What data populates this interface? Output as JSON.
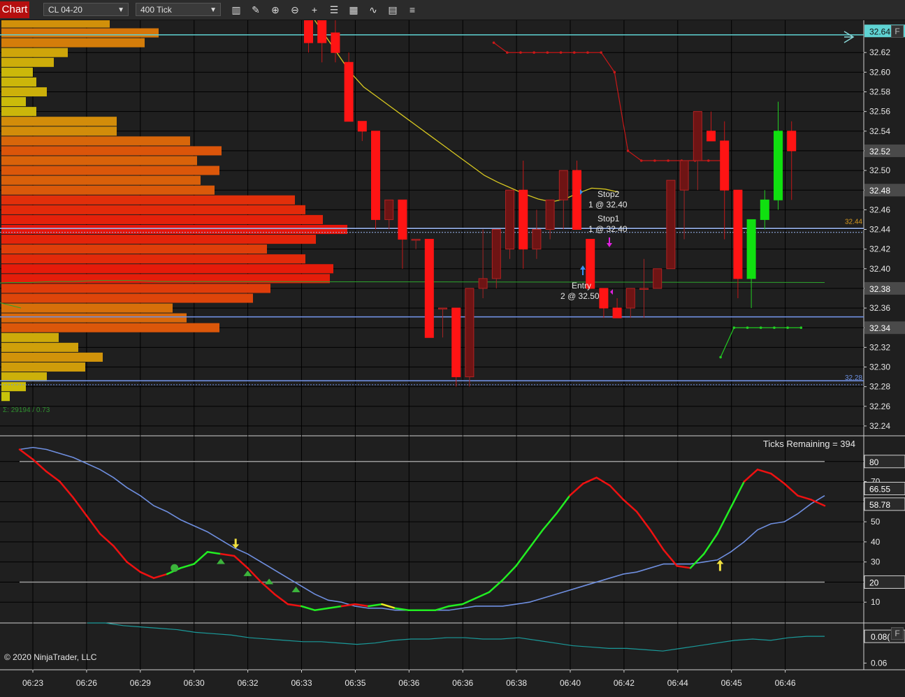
{
  "toolbar": {
    "title": "Chart",
    "instrument": "CL 04-20",
    "interval": "400 Tick",
    "buttons": [
      {
        "name": "bars-icon",
        "glyph": "▥"
      },
      {
        "name": "pencil-icon",
        "glyph": "✎"
      },
      {
        "name": "zoom-in-icon",
        "glyph": "⊕"
      },
      {
        "name": "zoom-out-icon",
        "glyph": "⊖"
      },
      {
        "name": "crosshair-icon",
        "glyph": "+"
      },
      {
        "name": "properties-icon",
        "glyph": "☰"
      },
      {
        "name": "strategy-icon",
        "glyph": "▦"
      },
      {
        "name": "indicator-icon",
        "glyph": "∿"
      },
      {
        "name": "template-icon",
        "glyph": "▤"
      },
      {
        "name": "menu-icon",
        "glyph": "≡"
      }
    ]
  },
  "chart_data": [
    {
      "type": "candlestick",
      "panel": "price",
      "ylim": [
        32.23,
        32.65
      ],
      "y_ticks": [
        32.24,
        32.26,
        32.28,
        32.3,
        32.32,
        32.34,
        32.36,
        32.38,
        32.4,
        32.42,
        32.44,
        32.46,
        32.48,
        32.5,
        32.52,
        32.54,
        32.56,
        32.58,
        32.6,
        32.62
      ],
      "price_markers": [
        {
          "label": "32.64",
          "color": "#5fd3d3"
        },
        {
          "label": "32.52",
          "color": "#4a4a4a"
        },
        {
          "label": "32.48",
          "color": "#4a4a4a"
        },
        {
          "label": "32.38",
          "color": "#4a4a4a"
        },
        {
          "label": "32.34",
          "color": "#4a4a4a"
        }
      ],
      "small_labels": [
        {
          "text": "32.44",
          "y": 32.443,
          "color": "#d89a20"
        },
        {
          "text": "32.28",
          "y": 32.284,
          "color": "#6b8fe0"
        }
      ],
      "horizontal_lines": [
        {
          "y": 32.638,
          "color": "#5fd3d3"
        },
        {
          "y": 32.441,
          "color": "#9ab6f0"
        },
        {
          "y": 32.351,
          "color": "#6f8fe0"
        },
        {
          "y": 32.286,
          "color": "#6f8fe0"
        }
      ],
      "candles": [
        {
          "o": 32.67,
          "h": 32.68,
          "l": 32.62,
          "c": 32.63
        },
        {
          "o": 32.66,
          "h": 32.67,
          "l": 32.61,
          "c": 32.63
        },
        {
          "o": 32.64,
          "h": 32.67,
          "l": 32.61,
          "c": 32.62
        },
        {
          "o": 32.61,
          "h": 32.62,
          "l": 32.55,
          "c": 32.55
        },
        {
          "o": 32.55,
          "h": 32.55,
          "l": 32.53,
          "c": 32.54
        },
        {
          "o": 32.54,
          "h": 32.54,
          "l": 32.44,
          "c": 32.45
        },
        {
          "o": 32.45,
          "h": 32.47,
          "l": 32.44,
          "c": 32.47
        },
        {
          "o": 32.47,
          "h": 32.47,
          "l": 32.4,
          "c": 32.43
        },
        {
          "o": 32.43,
          "h": 32.43,
          "l": 32.42,
          "c": 32.43
        },
        {
          "o": 32.43,
          "h": 32.43,
          "l": 32.33,
          "c": 32.33
        },
        {
          "o": 32.36,
          "h": 32.36,
          "l": 32.33,
          "c": 32.36
        },
        {
          "o": 32.36,
          "h": 32.36,
          "l": 32.28,
          "c": 32.29
        },
        {
          "o": 32.29,
          "h": 32.38,
          "l": 32.28,
          "c": 32.38
        },
        {
          "o": 32.38,
          "h": 32.44,
          "l": 32.37,
          "c": 32.39
        },
        {
          "o": 32.39,
          "h": 32.44,
          "l": 32.38,
          "c": 32.44
        },
        {
          "o": 32.42,
          "h": 32.48,
          "l": 32.41,
          "c": 32.48
        },
        {
          "o": 32.48,
          "h": 32.51,
          "l": 32.4,
          "c": 32.42
        },
        {
          "o": 32.42,
          "h": 32.46,
          "l": 32.41,
          "c": 32.44
        },
        {
          "o": 32.44,
          "h": 32.47,
          "l": 32.43,
          "c": 32.47
        },
        {
          "o": 32.47,
          "h": 32.5,
          "l": 32.44,
          "c": 32.5
        },
        {
          "o": 32.5,
          "h": 32.51,
          "l": 32.44,
          "c": 32.44
        },
        {
          "o": 32.43,
          "h": 32.43,
          "l": 32.38,
          "c": 32.38
        },
        {
          "o": 32.38,
          "h": 32.38,
          "l": 32.35,
          "c": 32.36
        },
        {
          "o": 32.36,
          "h": 32.37,
          "l": 32.35,
          "c": 32.35
        },
        {
          "o": 32.36,
          "h": 32.38,
          "l": 32.35,
          "c": 32.38
        },
        {
          "o": 32.38,
          "h": 32.41,
          "l": 32.35,
          "c": 32.38
        },
        {
          "o": 32.38,
          "h": 32.4,
          "l": 32.38,
          "c": 32.4
        },
        {
          "o": 32.4,
          "h": 32.49,
          "l": 32.4,
          "c": 32.49
        },
        {
          "o": 32.48,
          "h": 32.51,
          "l": 32.43,
          "c": 32.51
        },
        {
          "o": 32.51,
          "h": 32.56,
          "l": 32.48,
          "c": 32.56
        },
        {
          "o": 32.54,
          "h": 32.56,
          "l": 32.53,
          "c": 32.53
        },
        {
          "o": 32.53,
          "h": 32.55,
          "l": 32.43,
          "c": 32.48
        },
        {
          "o": 32.48,
          "h": 32.48,
          "l": 32.37,
          "c": 32.39
        },
        {
          "o": 32.39,
          "h": 32.45,
          "l": 32.36,
          "c": 32.45
        },
        {
          "o": 32.45,
          "h": 32.48,
          "l": 32.44,
          "c": 32.47
        },
        {
          "o": 32.47,
          "h": 32.57,
          "l": 32.46,
          "c": 32.54
        },
        {
          "o": 32.54,
          "h": 32.55,
          "l": 32.47,
          "c": 32.52
        }
      ],
      "volume_profile": [
        32.65,
        32.64,
        32.63,
        32.62,
        32.61,
        32.6,
        32.59,
        32.58,
        32.57,
        32.56,
        32.55,
        32.54,
        32.53,
        32.52,
        32.51,
        32.5,
        32.49,
        32.48,
        32.47,
        32.46,
        32.45,
        32.44,
        32.43,
        32.42,
        32.41,
        32.4,
        32.39,
        32.38,
        32.37,
        32.36,
        32.35,
        32.34,
        32.33,
        32.32,
        32.31,
        32.3,
        32.29,
        32.28,
        32.27
      ],
      "volume_profile_sizes": [
        155,
        225,
        205,
        95,
        75,
        45,
        50,
        65,
        35,
        50,
        165,
        165,
        270,
        315,
        280,
        312,
        285,
        305,
        420,
        435,
        460,
        495,
        450,
        380,
        435,
        475,
        470,
        385,
        360,
        245,
        265,
        312,
        82,
        110,
        145,
        120,
        65,
        35,
        12
      ],
      "volume_profile_text": "Σ: 29194 / 0.73",
      "ema": [
        32.66,
        32.64,
        32.62,
        32.6,
        32.585,
        32.575,
        32.565,
        32.555,
        32.545,
        32.535,
        32.525,
        32.515,
        32.505,
        32.495,
        32.488,
        32.482,
        32.476,
        32.471,
        32.468,
        32.471,
        32.477,
        32.482,
        32.481,
        32.478
      ],
      "ema_x_start": 20,
      "ema2": [
        32.385,
        32.385,
        32.385,
        32.385,
        32.386,
        32.386,
        32.387,
        32.387,
        32.388,
        32.388,
        32.388,
        32.387
      ],
      "ema2_x_start": 13,
      "stop_line": [
        32.63,
        32.62,
        32.62,
        32.62,
        32.62,
        32.62,
        32.62,
        32.62,
        32.62,
        32.6,
        32.52,
        32.51,
        32.51,
        32.51,
        32.51,
        32.51,
        32.51,
        32.51
      ],
      "stop_line_x_start": 15,
      "green_stop": [
        32.31,
        32.34,
        32.34,
        32.34,
        32.34,
        32.34,
        32.34
      ],
      "green_stop_x_start": 30.5,
      "labels": {
        "stop2": "Stop2",
        "stop2_qty": "1 @ 32.40",
        "stop1": "Stop1",
        "stop1_qty": "1 @ 32.40",
        "entry": "Entry",
        "entry_qty": "2 @ 32.50",
        "ticks_remaining": "Ticks Remaining = 394"
      }
    },
    {
      "type": "line",
      "panel": "stochastics",
      "ylim": [
        0,
        90
      ],
      "y_ticks": [
        10,
        20,
        30,
        40,
        50,
        60,
        70,
        80
      ],
      "levels": [
        20,
        80
      ],
      "value_labels": [
        {
          "label": "80",
          "color": "#e6e6e6",
          "value": 80
        },
        {
          "label": "66.55",
          "color": "#e6e6e6",
          "value": 66.55
        },
        {
          "label": "58.78",
          "color": "#e6e6e6",
          "value": 58.78
        },
        {
          "label": "20",
          "color": "#e6e6e6",
          "value": 20
        }
      ],
      "series": [
        {
          "values": [
            86,
            81,
            75,
            70,
            62,
            53,
            44,
            38,
            30,
            25,
            22,
            24,
            27,
            29,
            35,
            34,
            33,
            27,
            20,
            14,
            9,
            8,
            6,
            7,
            8,
            9,
            8,
            9,
            7,
            6,
            6,
            6,
            8,
            9,
            12,
            15,
            21,
            28,
            37,
            46,
            54,
            63,
            69,
            72,
            68,
            61,
            55,
            46,
            36,
            28,
            27,
            34,
            44,
            57,
            70,
            76,
            74,
            69,
            63,
            61,
            58
          ]
        },
        {
          "values": [
            86,
            87,
            86,
            84,
            82,
            79,
            76,
            72,
            67,
            63,
            58,
            55,
            51,
            48,
            45,
            41,
            37,
            34,
            30,
            26,
            22,
            18,
            14,
            11,
            10,
            8,
            7,
            7,
            6,
            6,
            6,
            6,
            6,
            7,
            8,
            8,
            8,
            9,
            10,
            12,
            14,
            16,
            18,
            20,
            22,
            24,
            25,
            27,
            29,
            29,
            29,
            30,
            31,
            35,
            40,
            46,
            49,
            50,
            54,
            59,
            63
          ]
        }
      ],
      "series_x_step": 0.5,
      "segment_colors": [
        "red",
        "red",
        "red",
        "red",
        "red",
        "red",
        "red",
        "red",
        "red",
        "red",
        "red",
        "green",
        "green",
        "green",
        "green",
        "red",
        "red",
        "red",
        "red",
        "red",
        "red",
        "green",
        "green",
        "green",
        "red",
        "red",
        "green",
        "yellow",
        "green",
        "green",
        "green",
        "green",
        "green",
        "green",
        "green",
        "green",
        "green",
        "green",
        "green",
        "green",
        "green",
        "red",
        "red",
        "red",
        "red",
        "red",
        "red",
        "red",
        "red",
        "red",
        "green",
        "green",
        "green",
        "green",
        "red",
        "red",
        "red",
        "red",
        "red",
        "red"
      ],
      "triangles_up": [
        [
          8.5,
          30
        ],
        [
          9.5,
          24
        ],
        [
          10.3,
          20
        ],
        [
          11.3,
          16
        ]
      ],
      "triangles_down": [
        [
          41.5,
          67
        ],
        [
          43,
          74
        ]
      ],
      "dots": [
        [
          11.8,
          27
        ],
        [
          44.5,
          71
        ]
      ],
      "arrows_down": [
        [
          17,
          36
        ]
      ],
      "arrows_up": [
        [
          52,
          29
        ]
      ]
    },
    {
      "type": "line",
      "panel": "third",
      "ylim": [
        0.055,
        0.09
      ],
      "y_ticks": [
        0.06
      ],
      "value_labels": [
        {
          "label": "0.08(",
          "color": "#e6e6e6",
          "value": 0.08
        }
      ],
      "series": [
        {
          "values": [
            0.09,
            0.09,
            0.088,
            0.087,
            0.086,
            0.085,
            0.083,
            0.082,
            0.081,
            0.079,
            0.078,
            0.077,
            0.076,
            0.076,
            0.075,
            0.074,
            0.075,
            0.077,
            0.078,
            0.078,
            0.079,
            0.079,
            0.078,
            0.078,
            0.079,
            0.077,
            0.075,
            0.073,
            0.072,
            0.071,
            0.071,
            0.07,
            0.069,
            0.071,
            0.073,
            0.075,
            0.077,
            0.078,
            0.077,
            0.079,
            0.08,
            0.08
          ]
        }
      ]
    }
  ],
  "x_axis": {
    "labels": [
      "06:23",
      "06:26",
      "06:29",
      "06:30",
      "06:32",
      "06:33",
      "06:35",
      "06:36",
      "06:36",
      "06:38",
      "06:40",
      "06:42",
      "06:44",
      "06:45",
      "06:46"
    ]
  },
  "copyright": "© 2020 NinjaTrader, LLC",
  "corner_label": "F"
}
